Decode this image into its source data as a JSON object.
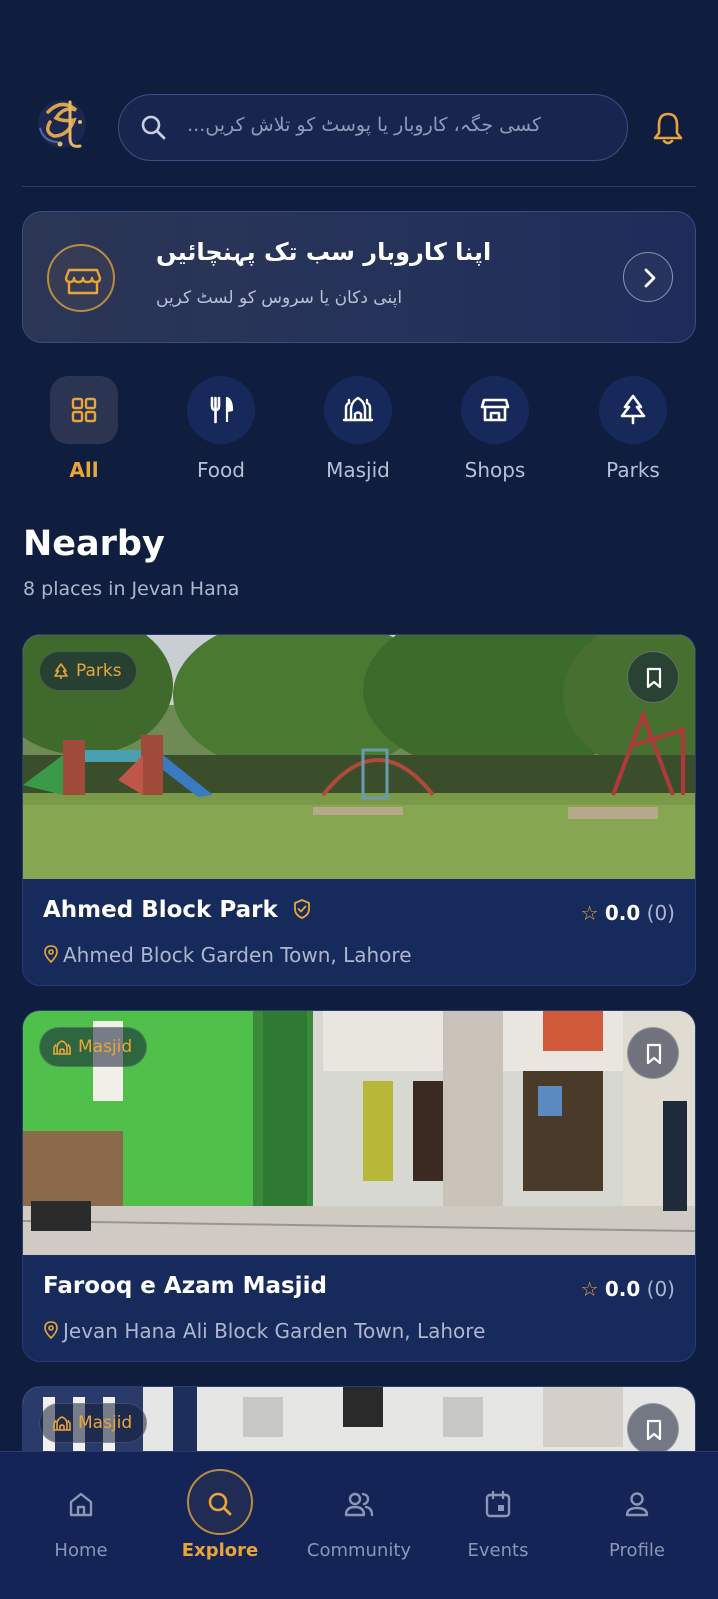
{
  "header": {
    "search_placeholder": "کسی جگہ، کاروبار یا پوسٹ کو تلاش کریں...",
    "logo_icon": "calligraphy-logo",
    "notification_icon": "bell-icon"
  },
  "banner": {
    "title": "اپنا کاروبار سب تک پہنچائیں",
    "subtitle": "اپنی دکان یا سروس کو لسٹ کریں",
    "icon": "store-icon",
    "action_icon": "chevron-right-icon"
  },
  "categories": [
    {
      "label": "All",
      "icon": "grid-icon",
      "active": true
    },
    {
      "label": "Food",
      "icon": "utensils-icon",
      "active": false
    },
    {
      "label": "Masjid",
      "icon": "mosque-icon",
      "active": false
    },
    {
      "label": "Shops",
      "icon": "shop-icon",
      "active": false
    },
    {
      "label": "Parks",
      "icon": "tree-icon",
      "active": false
    }
  ],
  "nearby": {
    "title": "Nearby",
    "subtitle": "8 places in Jevan Hana"
  },
  "places": [
    {
      "category": "Parks",
      "name": "Ahmed Block Park",
      "verified": true,
      "rating": "0.0",
      "reviews": "(0)",
      "address": "Ahmed Block Garden Town, Lahore"
    },
    {
      "category": "Masjid",
      "name": "Farooq e Azam Masjid",
      "verified": false,
      "rating": "0.0",
      "reviews": "(0)",
      "address": "Jevan Hana Ali Block Garden Town, Lahore"
    },
    {
      "category": "Masjid"
    }
  ],
  "bottom_nav": [
    {
      "label": "Home",
      "icon": "home-icon",
      "active": false
    },
    {
      "label": "Explore",
      "icon": "search-icon",
      "active": true
    },
    {
      "label": "Community",
      "icon": "people-icon",
      "active": false
    },
    {
      "label": "Events",
      "icon": "calendar-icon",
      "active": false
    },
    {
      "label": "Profile",
      "icon": "user-icon",
      "active": false
    }
  ],
  "colors": {
    "background": "#0f1d3f",
    "accent": "#e8a53a",
    "card": "#172a5c"
  }
}
